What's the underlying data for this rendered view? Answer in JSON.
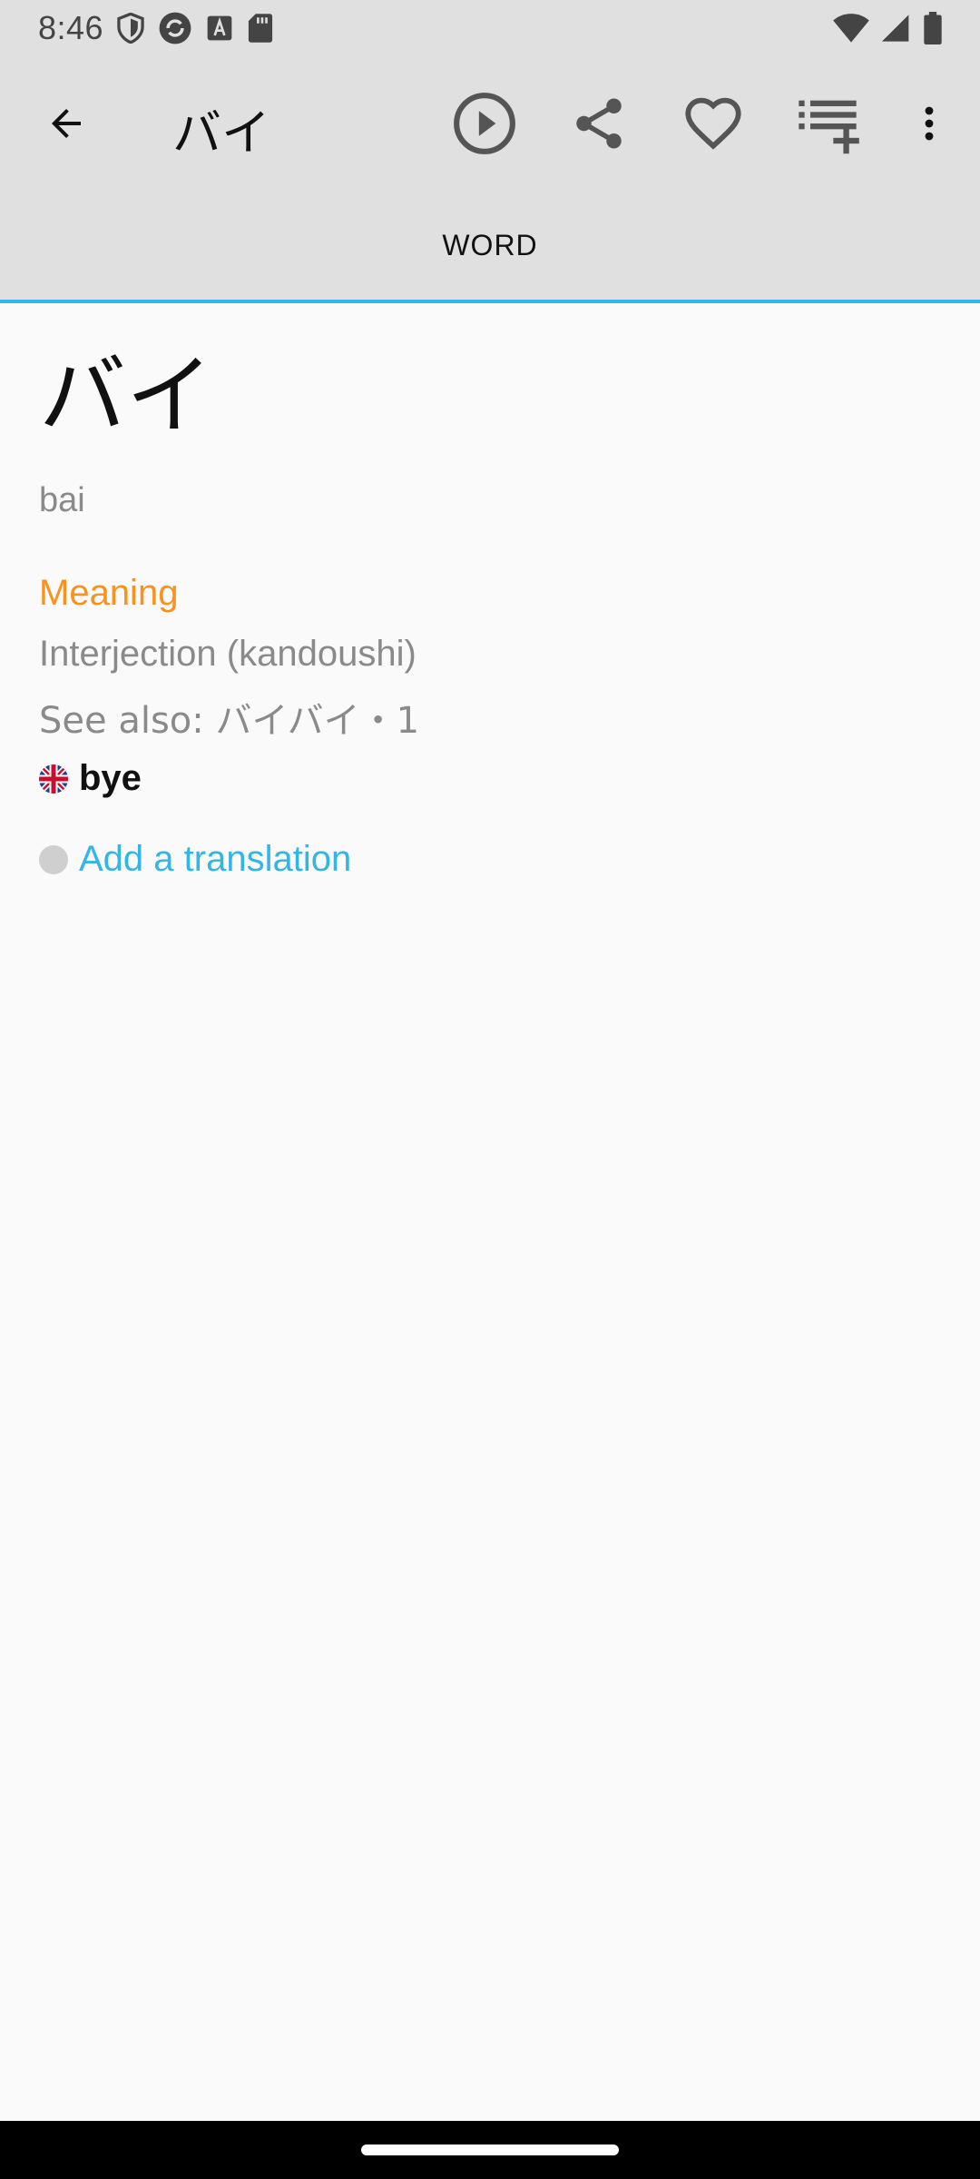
{
  "status_bar": {
    "time": "8:46",
    "left_icons": [
      "shield-icon",
      "sync-icon",
      "font-icon",
      "sd-card-icon"
    ],
    "right_icons": [
      "wifi-icon",
      "signal-icon",
      "battery-icon"
    ]
  },
  "app_bar": {
    "title": "バイ",
    "actions": [
      "back-arrow-icon",
      "play-icon",
      "share-icon",
      "heart-icon",
      "playlist-add-icon",
      "more-vert-icon"
    ]
  },
  "tabs": [
    {
      "label": "WORD",
      "selected": true
    }
  ],
  "colors": {
    "accent": "#33b5e5",
    "section": "#f7931e",
    "bar_bg": "#e0e0e0",
    "muted_text": "#8a8a8a"
  },
  "entry": {
    "headword": "バイ",
    "reading": "bai",
    "meaning_label": "Meaning",
    "part_of_speech": "Interjection (kandoushi)",
    "see_also": "See also: バイバイ・1",
    "translation": "bye",
    "translation_flag": "uk-flag-icon",
    "add_translation": "Add a translation"
  }
}
